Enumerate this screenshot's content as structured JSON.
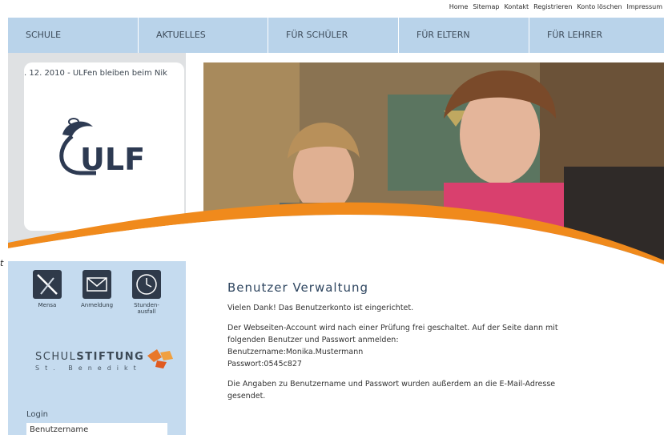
{
  "toplinks": [
    "Home",
    "Sitemap",
    "Kontakt",
    "Registrieren",
    "Konto löschen",
    "Impressum"
  ],
  "nav": [
    "SCHULE",
    "AKTUELLES",
    "FÜR SCHÜLER",
    "FÜR ELTERN",
    "FÜR LEHRER"
  ],
  "ticker": ". 12. 2010 - ULFen bleiben beim Nik",
  "logo_text": "ULF",
  "side_mark": "t",
  "quicklinks": [
    {
      "label": "Mensa",
      "icon": "cutlery-icon"
    },
    {
      "label": "Anmeldung",
      "icon": "envelope-icon"
    },
    {
      "label": "Stunden-\nausfall",
      "icon": "clock-icon"
    }
  ],
  "stiftung": {
    "name_light": "SCHUL",
    "name_bold": "STIFTUNG",
    "sub": "St. Benedikt"
  },
  "login": {
    "title": "Login",
    "username_placeholder": "Benutzername"
  },
  "content": {
    "heading": "Benutzer Verwaltung",
    "p1": "Vielen Dank! Das Benutzerkonto ist eingerichtet.",
    "p2_line1": "Der Webseiten-Account wird nach einer Prüfung frei geschaltet. Auf der Seite dann mit",
    "p2_line2": "folgenden Benutzer und Passwort anmelden:",
    "p2_line3": "Benutzername:Monika.Mustermann",
    "p2_line4": "Passwort:0545c827",
    "p3_line1": "Die Angaben zu Benutzername und Passwort wurden außerdem an die E-Mail-Adresse",
    "p3_line2": "gesendet."
  },
  "colors": {
    "nav_bg": "#b9d3ea",
    "swoosh": "#f08a1c",
    "heading": "#2f4660",
    "left_blue": "#c5dbef"
  }
}
